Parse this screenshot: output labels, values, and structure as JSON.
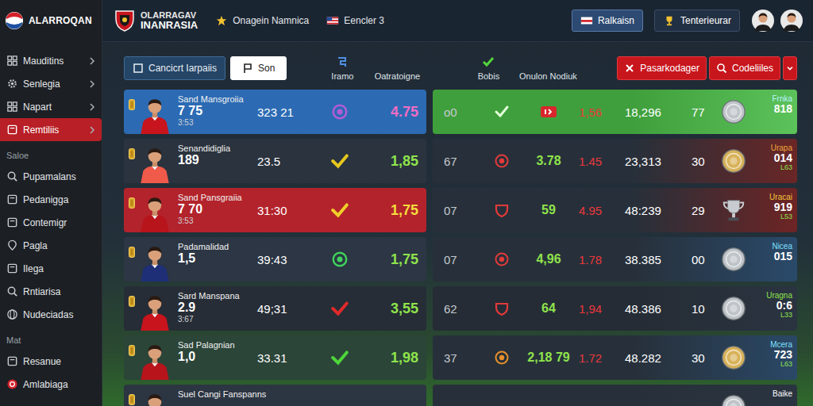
{
  "brand": {
    "name": "ALARROQAN"
  },
  "header": {
    "club_line1": "OLARRAGAV",
    "club_line2": "INANRASIA",
    "items": [
      {
        "label": "Onagein Namnica"
      },
      {
        "label": "Eencler 3"
      }
    ],
    "buttons": [
      {
        "label": "Ralkaisn"
      },
      {
        "label": "Tenterieurar"
      }
    ]
  },
  "sidebar": {
    "items": [
      {
        "kind": "item",
        "label": "Mauditins",
        "expandable": true,
        "selected": false
      },
      {
        "kind": "item",
        "label": "Senlegia",
        "expandable": true,
        "selected": false
      },
      {
        "kind": "item",
        "label": "Napart",
        "expandable": true,
        "selected": false
      },
      {
        "kind": "item",
        "label": "Remtiliis",
        "expandable": true,
        "selected": true
      },
      {
        "kind": "heading",
        "label": "Saloe",
        "expandable": false,
        "selected": false
      },
      {
        "kind": "item",
        "label": "Pupamalans",
        "expandable": false,
        "selected": false
      },
      {
        "kind": "item",
        "label": "Pedanigga",
        "expandable": false,
        "selected": false
      },
      {
        "kind": "item",
        "label": "Contemigr",
        "expandable": false,
        "selected": false
      },
      {
        "kind": "item",
        "label": "Pagla",
        "expandable": false,
        "selected": false
      },
      {
        "kind": "item",
        "label": "Ilega",
        "expandable": false,
        "selected": false
      },
      {
        "kind": "item",
        "label": "Rntiarisa",
        "expandable": false,
        "selected": false
      },
      {
        "kind": "item",
        "label": "Nudeciadas",
        "expandable": false,
        "selected": false
      },
      {
        "kind": "heading",
        "label": "Mat",
        "expandable": false,
        "selected": false
      },
      {
        "kind": "item",
        "label": "Resanue",
        "expandable": false,
        "selected": false
      },
      {
        "kind": "item",
        "label": "Amlabiaga",
        "expandable": false,
        "selected": false
      }
    ]
  },
  "toolbar": {
    "buttons": [
      {
        "label": "Cancicrt Iarpaiis",
        "selected": false
      },
      {
        "label": "Son",
        "selected": true
      }
    ],
    "columns": [
      "Iramo",
      "Oatratoigne",
      "Bobis",
      "Onulon Nodiuk"
    ],
    "actions": [
      {
        "label": "Pasarkodager"
      },
      {
        "label": "Codeliiles"
      }
    ]
  },
  "rows": [
    {
      "name": "Sand Mansgroiia",
      "number": "7 75",
      "sub": "3:53",
      "time": "323 21",
      "mark": {
        "kind": "circle",
        "color": "#b45cd6"
      },
      "odds": "4.75",
      "odds_color": "#f06cc4",
      "color": "#2c6bb3",
      "jersey": "#c8141c",
      "right": {
        "kind": "highlight",
        "color": "#3f9f3c",
        "accent": "#5cc25a",
        "count": "o0",
        "sign": {
          "kind": "check",
          "color": "#e2ffd8"
        },
        "tag_color": "#d9262c",
        "loss": "1,56",
        "total": "18,296",
        "rank": "77",
        "prize": {
          "kind": "medal",
          "color": "#bfc4c9"
        },
        "label": "Frnka",
        "label_color": "#b8f4ff",
        "value": "818"
      }
    },
    {
      "name": "Senandidiglia",
      "number": "189",
      "time": "23.5",
      "mark": {
        "kind": "check",
        "color": "#e6c81e"
      },
      "odds": "1,85",
      "odds_color": "#8fe34c",
      "color": "#2a333e",
      "jersey": "#f05a4a",
      "right": {
        "kind": "normal",
        "color": "#27303a",
        "accent": "#6a2626",
        "count": "67",
        "sign": {
          "kind": "circle",
          "color": "#e23a3a"
        },
        "gain": "3.78",
        "loss": "1.45",
        "total": "23,313",
        "rank": "30",
        "prize": {
          "kind": "medal",
          "color": "#d8b25a"
        },
        "label": "Urapa",
        "label_color": "#f0a43a",
        "value": "014",
        "sub": "L63"
      }
    },
    {
      "name": "Sand Pansgraiia",
      "number": "7 70",
      "sub": "3:53",
      "time": "31:30",
      "mark": {
        "kind": "check",
        "color": "#f0d02a"
      },
      "odds": "1,75",
      "odds_color": "#f4dc3c",
      "color": "#b3232b",
      "jersey": "#b8141c",
      "right": {
        "kind": "normal",
        "color": "#27303a",
        "accent": "#6e2424",
        "count": "07",
        "sign": {
          "kind": "shield",
          "color": "#e23a3a"
        },
        "gain": "59",
        "loss": "4.95",
        "total": "48:239",
        "rank": "29",
        "prize": {
          "kind": "trophy",
          "color": "#c8ccd0"
        },
        "label": "Uracai",
        "label_color": "#f0c43a",
        "value": "919",
        "sub": "L53"
      }
    },
    {
      "name": "Padamalidad",
      "number": "1,5",
      "time": "39:43",
      "mark": {
        "kind": "circle",
        "color": "#3ed35a"
      },
      "odds": "1,75",
      "odds_color": "#8fe34c",
      "color": "#2c3644",
      "jersey": "#1e2f78",
      "right": {
        "kind": "normal",
        "color": "#27303a",
        "accent": "#2a4a6a",
        "count": "07",
        "sign": {
          "kind": "circle",
          "color": "#e23a3a"
        },
        "gain": "4,96",
        "loss": "1.78",
        "total": "38.385",
        "rank": "00",
        "prize": {
          "kind": "medal",
          "color": "#bfc4c9"
        },
        "label": "Nicea",
        "label_color": "#7fe0ff",
        "value": "015"
      }
    },
    {
      "name": "Sard Manspana",
      "number": "2.9",
      "sub": "3:67",
      "time": "49;31",
      "mark": {
        "kind": "check",
        "color": "#e02a2a"
      },
      "odds": "3,55",
      "odds_color": "#8fe34c",
      "color": "#262d36",
      "jersey": "#c8141c",
      "right": {
        "kind": "normal",
        "color": "#252c35",
        "accent": "#2a3440",
        "count": "62",
        "sign": {
          "kind": "shield",
          "color": "#e23a3a"
        },
        "gain": "64",
        "loss": "1,94",
        "total": "48.386",
        "rank": "10",
        "prize": {
          "kind": "medal",
          "color": "#bfc4c9"
        },
        "label": "Uragna",
        "label_color": "#8fe34c",
        "value": "0:6",
        "sub": "L33"
      }
    },
    {
      "name": "Sad Palagnian",
      "number": "1,0",
      "time": "33.31",
      "mark": {
        "kind": "check",
        "color": "#4ed63a"
      },
      "odds": "1,98",
      "odds_color": "#8fe34c",
      "color": "#2b4538",
      "jersey": "#b8141c",
      "right": {
        "kind": "normal",
        "color": "#27303a",
        "accent": "#2a4866",
        "count": "37",
        "sign": {
          "kind": "circle",
          "color": "#e8902a"
        },
        "gain": "2,18 79",
        "loss": "1.72",
        "total": "48.282",
        "rank": "30",
        "prize": {
          "kind": "medal",
          "color": "#d8b25a"
        },
        "label": "Mcera",
        "label_color": "#7fe0ff",
        "value": "723",
        "sub": "L63"
      }
    },
    {
      "name": "Suel Cangi Fanspanns",
      "color": "#2c3542",
      "jersey": "#c8141c",
      "right": {
        "kind": "partial",
        "color": "#27303a",
        "accent": "#2a3440",
        "prize": {
          "kind": "medal",
          "color": "#bfc4c9"
        },
        "label": "Baike",
        "label_color": "#ffffff"
      }
    }
  ]
}
